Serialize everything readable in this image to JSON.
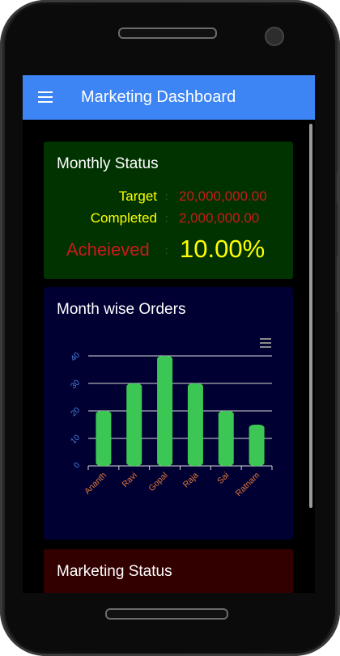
{
  "app": {
    "title": "Marketing Dashboard"
  },
  "icons": {
    "menu": "hamburger-menu-icon",
    "chart_menu": "chart-context-menu-icon"
  },
  "colors": {
    "appbar": "#3d85f5",
    "status_card": "#003300",
    "orders_card": "#000033",
    "marketing_card": "#330000",
    "bar": "#3cc653",
    "label_yellow": "#ffff00",
    "value_red": "#cc1a1a",
    "axis_blue": "#4a7fd6",
    "tick_orange": "#e0793a"
  },
  "monthly_status": {
    "title": "Monthly Status",
    "target_label": "Target",
    "target_value": "20,000,000.00",
    "completed_label": "Completed",
    "completed_value": "2,000,000.00",
    "achieved_label": "Acheieved",
    "achieved_value": "10.00%",
    "separator": ":"
  },
  "orders": {
    "title": "Month wise Orders"
  },
  "marketing_status": {
    "title": "Marketing Status"
  },
  "chart_data": {
    "type": "bar",
    "categories": [
      "Ananth",
      "Ravi",
      "Gopal",
      "Raja",
      "Sai",
      "Ratnam"
    ],
    "values": [
      20,
      30,
      40,
      30,
      20,
      15
    ],
    "ylim": [
      0,
      40
    ],
    "yticks": [
      0,
      10,
      20,
      30,
      40
    ],
    "grid": true,
    "legend": "none"
  }
}
